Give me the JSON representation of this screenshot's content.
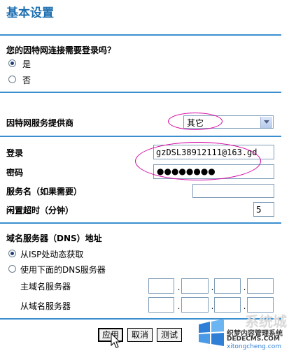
{
  "page_title": "基本设置",
  "login_question": {
    "label": "您的因特网连接需要登录吗？",
    "options": [
      {
        "label": "是",
        "selected": true
      },
      {
        "label": "否",
        "selected": false
      }
    ]
  },
  "isp": {
    "label": "因特网服务提供商",
    "selected": "其它"
  },
  "login": {
    "label": "登录",
    "value": "gzDSL38912111@163.gd"
  },
  "password": {
    "label": "密码",
    "value": "●●●●●●●●"
  },
  "service_name": {
    "label": "服务名（如果需要）",
    "value": ""
  },
  "idle_timeout": {
    "label": "闲置超时（分钟）",
    "value": "5"
  },
  "dns": {
    "heading": "域名服务器（DNS）地址",
    "options": [
      {
        "label": "从ISP处动态获取",
        "selected": true
      },
      {
        "label": "使用下面的DNS服务器",
        "selected": false
      }
    ],
    "primary_label": "主域名服务器",
    "secondary_label": "从域名服务器",
    "separator": "."
  },
  "buttons": {
    "apply": "应用",
    "cancel": "取消",
    "test": "测试"
  },
  "watermark": {
    "text1": "织梦内容管理系统",
    "text2": "DEDECMS.COM",
    "text3": "xitongcheng.com",
    "logo_text": "系统城"
  },
  "colors": {
    "accent": "#1e6fb0",
    "rule": "#3b8fcf",
    "highlight_oval": "#d600a0"
  }
}
